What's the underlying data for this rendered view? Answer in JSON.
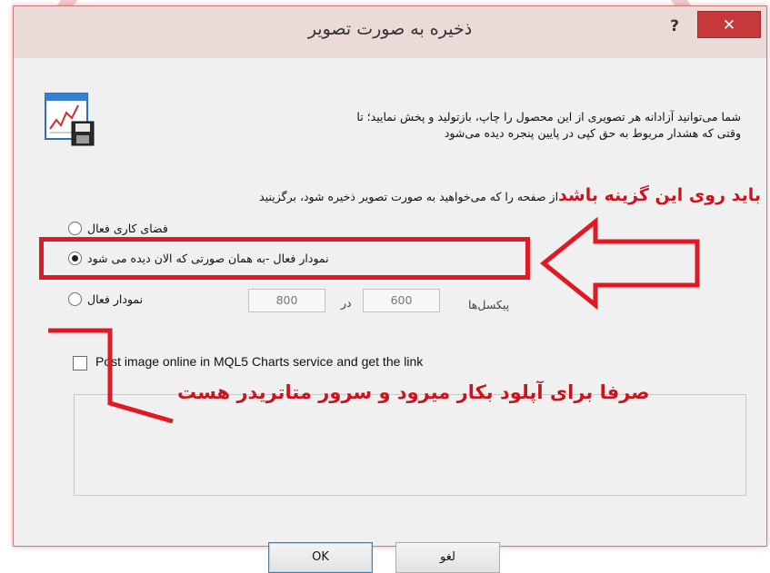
{
  "window": {
    "title": "ذخیره به صورت تصویر",
    "help_label": "?",
    "close_label": "✕"
  },
  "info": {
    "line1": "شما می‌توانید آزادانه هر تصویری از این محصول را چاپ، بازتولید و پخش نمایید؛ تا",
    "line2": "وقتی که هشدار مربوط به حق کپی در پایین پنجره دیده می‌شود"
  },
  "prompt": {
    "text": "از صفحه را که می‌خواهید به صورت تصویر ذخیره شود، برگزینید"
  },
  "annotations": {
    "top": "باید روی این گزینه باشد",
    "bottom": "صرفا برای آپلود بکار میرود و سرور متاتریدر هست"
  },
  "options": [
    {
      "label": "فضای کاری فعال",
      "checked": false
    },
    {
      "label": "نمودار فعال -به همان صورتی که الان دیده می شود",
      "checked": true
    },
    {
      "label": "نمودار فعال",
      "checked": false
    }
  ],
  "size": {
    "pixels_label": "پیکسل‌ها",
    "width_value": "600",
    "by_label": "در",
    "height_value": "800"
  },
  "post_online": {
    "label": "Post image online in MQL5 Charts service and get the link",
    "checked": false
  },
  "buttons": {
    "ok": "OK",
    "cancel": "لغو"
  },
  "colors": {
    "annotation_red": "#d0121d",
    "close_button": "#c7383b"
  },
  "icons": {
    "app": "chart-window-save-icon"
  }
}
